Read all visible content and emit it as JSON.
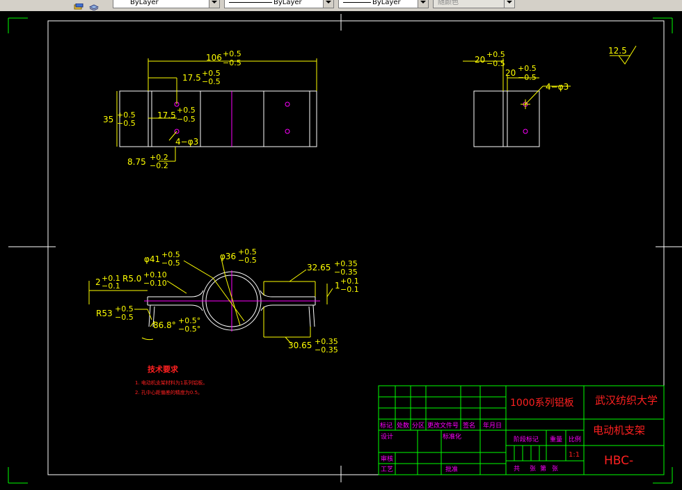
{
  "toolbar": {
    "layer_icons": [
      "layer-states-icon",
      "layers-icon"
    ],
    "color_combo": {
      "value": "ByLayer"
    },
    "linetype_combo": {
      "value": "ByLayer"
    },
    "lineweight_combo": {
      "value": "ByLayer"
    },
    "plotstyle_combo": {
      "value": "随颜色"
    }
  },
  "drawing": {
    "colors": {
      "border": "#ffffff",
      "title_grid": "#00ff00",
      "dim": "#ffff00",
      "outline": "#ffffff",
      "center": "#ff00ff",
      "text_red": "#ff2020"
    },
    "top_view": {
      "dim_overall": "106",
      "dim_overall_tol_upper": "+0.5",
      "dim_overall_tol_lower": "−0.5",
      "dim_hole_x": "17.5",
      "dim_hole_x_tol_upper": "+0.5",
      "dim_hole_x_tol_lower": "−0.5",
      "dim_height": "35",
      "dim_height_tol_upper": "+0.5",
      "dim_height_tol_lower": "−0.5",
      "dim_hole_y": "17.5",
      "dim_hole_y_tol_upper": "+0.5",
      "dim_hole_y_tol_lower": "−0.5",
      "dim_holes": "4−φ3",
      "dim_edge": "8.75",
      "dim_edge_tol_upper": "+0.2",
      "dim_edge_tol_lower": "−0.2"
    },
    "side_view": {
      "dim_a": "20",
      "dim_a_tol_upper": "+0.5",
      "dim_a_tol_lower": "−0.5",
      "dim_b": "20",
      "dim_b_tol_upper": "+0.5",
      "dim_b_tol_lower": "−0.5",
      "dim_holes": "4−φ3"
    },
    "roughness": "12.5",
    "front_view": {
      "dim_outer_dia": "φ41",
      "dim_outer_tol_upper": "+0.5",
      "dim_outer_tol_lower": "−0.5",
      "dim_inner_dia": "φ36",
      "dim_inner_tol_upper": "+0.5",
      "dim_inner_tol_lower": "−0.5",
      "dim_flange_top": "32.65",
      "dim_flange_top_tol_upper": "+0.35",
      "dim_flange_top_tol_lower": "−0.35",
      "dim_flange_bottom": "30.65",
      "dim_flange_bottom_tol_upper": "+0.35",
      "dim_flange_bottom_tol_lower": "−0.35",
      "dim_thk_left": "2",
      "dim_thk_left_tol_upper": "+0.1",
      "dim_thk_left_tol_lower": "−0.1",
      "dim_r5": "R5.0",
      "dim_r5_tol_upper": "+0.10",
      "dim_r5_tol_lower": "−0.10",
      "dim_thk_right": "1",
      "dim_thk_right_tol_upper": "+0.1",
      "dim_thk_right_tol_lower": "−0.1",
      "dim_r53": "R53",
      "dim_r53_tol_upper": "+0.5",
      "dim_r53_tol_lower": "−0.5",
      "dim_angle": "86.8°",
      "dim_angle_tol_upper": "+0.5°",
      "dim_angle_tol_lower": "−0.5°"
    },
    "tech_req": {
      "title": "技术要求",
      "line1": "1. 电动机支架材料为1系列铝板。",
      "line2": "2. 孔中心距偏差的精度为0.5。"
    },
    "title_block": {
      "material": "1000系列铝板",
      "school": "武汉纺织大学",
      "part_name": "电动机支架",
      "drawing_no": "HBC-",
      "scale": "1:1",
      "hdr_mark": "标记",
      "hdr_count": "处数",
      "hdr_zone": "分区",
      "hdr_doc": "更改文件号",
      "hdr_sign": "签名",
      "hdr_date": "年月日",
      "lbl_design": "设计",
      "lbl_standard": "标准化",
      "lbl_stage": "阶段标记",
      "lbl_weight": "重量",
      "lbl_scale": "比例",
      "lbl_review": "审核",
      "lbl_process": "工艺",
      "lbl_approve": "批准",
      "lbl_total": "共",
      "lbl_sheet": "张",
      "lbl_no": "第",
      "lbl_sheet2": "张"
    }
  }
}
